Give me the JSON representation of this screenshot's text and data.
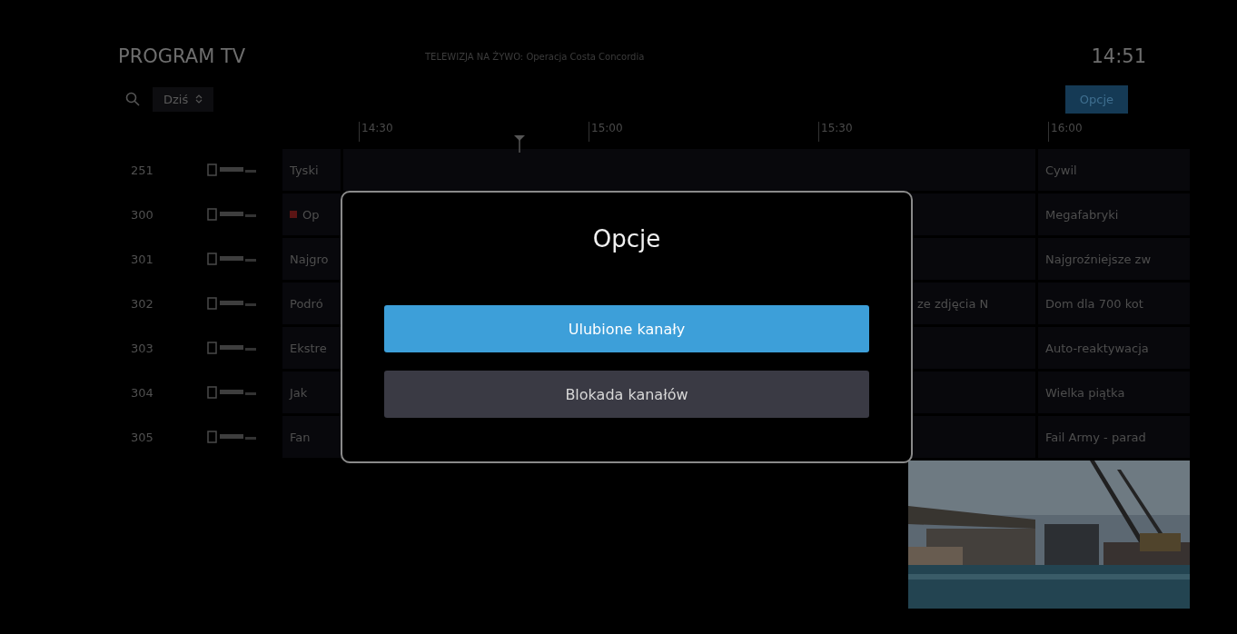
{
  "header": {
    "title": "PROGRAM TV",
    "now_playing": "TELEWIZJA NA ŻYWO: Operacja Costa Concordia",
    "clock": "14:51"
  },
  "toolbar": {
    "day": "Dziś",
    "options_button": "Opcje"
  },
  "timeline": [
    "14:30",
    "15:00",
    "15:30",
    "16:00"
  ],
  "channels": [
    {
      "number": "251",
      "recording": false,
      "left": "Tyski",
      "right": "Cywil"
    },
    {
      "number": "300",
      "recording": true,
      "left": "Op",
      "right": "Megafabryki"
    },
    {
      "number": "301",
      "recording": false,
      "left": "Najgro",
      "right": "Najgroźniejsze zw"
    },
    {
      "number": "302",
      "recording": false,
      "left": "Podró",
      "middle": "ze zdjęcia N",
      "right": "Dom dla 700 kot"
    },
    {
      "number": "303",
      "recording": false,
      "left": "Ekstre",
      "right": "Auto-reaktywacja"
    },
    {
      "number": "304",
      "recording": false,
      "left": "Jak",
      "right": "Wielka piątka"
    },
    {
      "number": "305",
      "recording": false,
      "left": "Fan",
      "right": "Fail Army - parad"
    }
  ],
  "dialog": {
    "title": "Opcje",
    "options": [
      {
        "label": "Ulubione kanały",
        "selected": true
      },
      {
        "label": "Blokada kanałów",
        "selected": false
      }
    ]
  }
}
